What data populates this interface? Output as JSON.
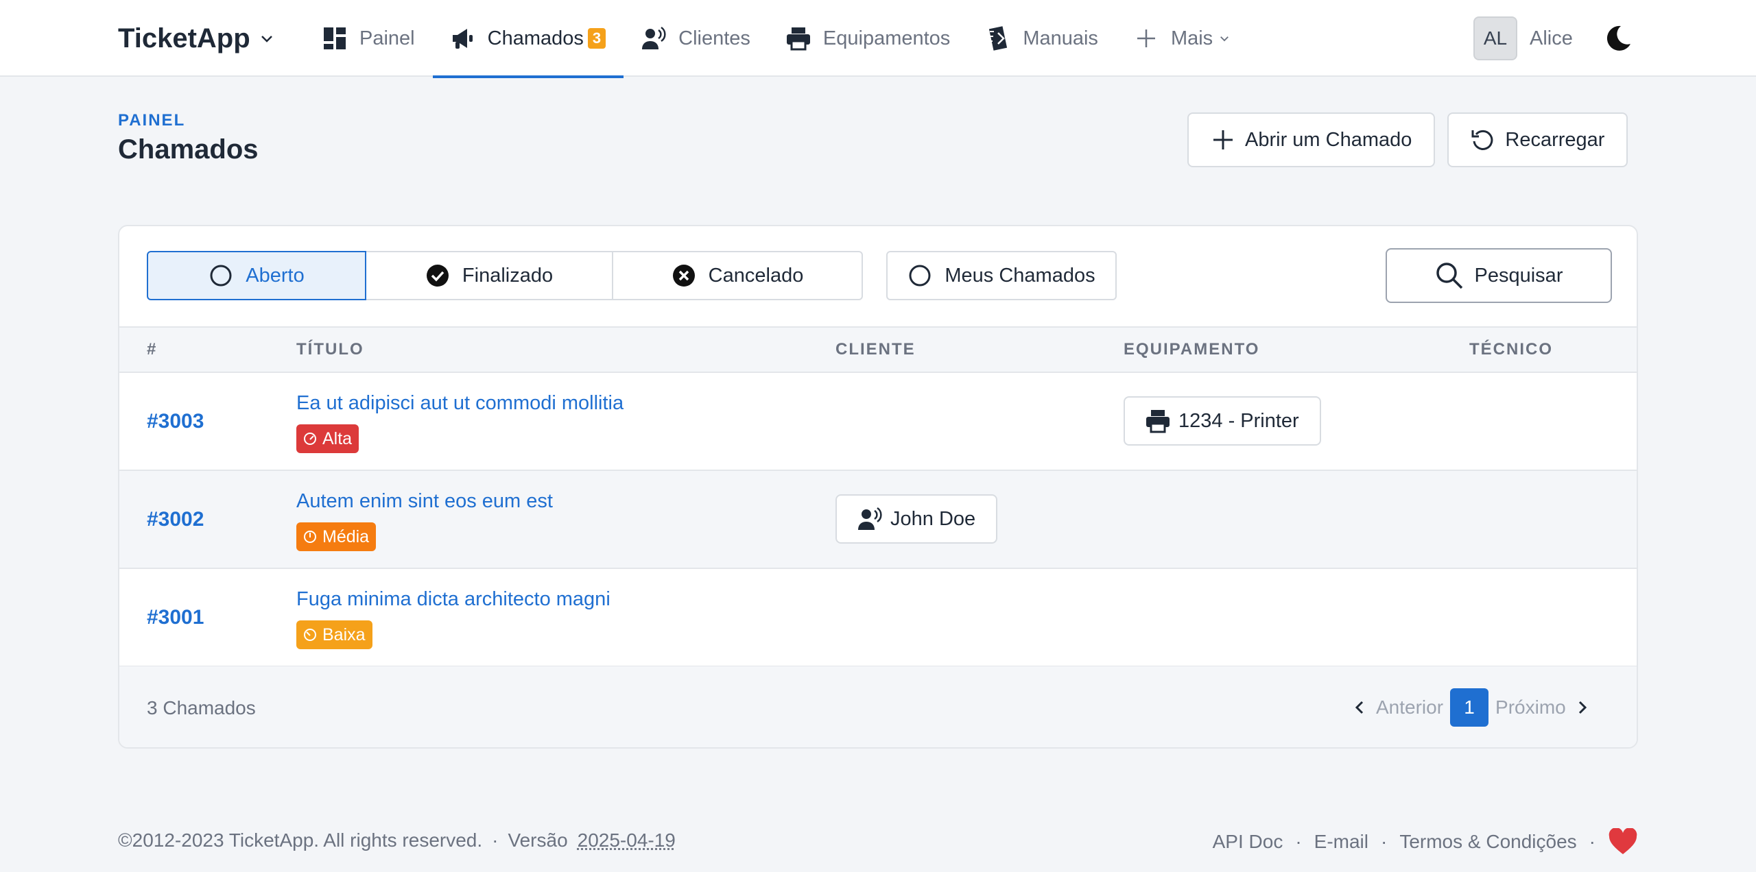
{
  "colors": {
    "primary": "#1f6fd1",
    "badge": "#f5a11a",
    "alta": "#dc3a3a",
    "media": "#f57c10",
    "baixa": "#f5a11a",
    "heart": "#e0393e"
  },
  "navbar": {
    "brand": "TicketApp",
    "items": [
      {
        "label": "Painel",
        "icon": "dashboard-icon"
      },
      {
        "label": "Chamados",
        "icon": "megaphone-icon",
        "badge": "3",
        "active": true
      },
      {
        "label": "Clientes",
        "icon": "customer-icon"
      },
      {
        "label": "Equipamentos",
        "icon": "printer-icon"
      },
      {
        "label": "Manuais",
        "icon": "manual-icon"
      },
      {
        "label": "Mais",
        "icon": "plus-icon"
      }
    ],
    "user_initials": "AL",
    "user_name": "Alice"
  },
  "header": {
    "breadcrumb": "PAINEL",
    "title": "Chamados",
    "new_button": "Abrir um Chamado",
    "reload_button": "Recarregar"
  },
  "filters": {
    "open": "Aberto",
    "finished": "Finalizado",
    "canceled": "Cancelado",
    "mine": "Meus Chamados",
    "search": "Pesquisar"
  },
  "table": {
    "columns": {
      "id": "#",
      "title": "TÍTULO",
      "client": "CLIENTE",
      "equipment": "EQUIPAMENTO",
      "tech": "TÉCNICO"
    },
    "rows": [
      {
        "id": "#3003",
        "title": "Ea ut adipisci aut ut commodi mollitia",
        "priority": "Alta",
        "client": "",
        "equipment": "1234 - Printer"
      },
      {
        "id": "#3002",
        "title": "Autem enim sint eos eum est",
        "priority": "Média",
        "client": "John Doe",
        "equipment": ""
      },
      {
        "id": "#3001",
        "title": "Fuga minima dicta architecto magni",
        "priority": "Baixa",
        "client": "",
        "equipment": ""
      }
    ],
    "count": "3 Chamados",
    "pagination": {
      "prev": "Anterior",
      "current": "1",
      "next": "Próximo"
    }
  },
  "footer": {
    "copyright": "©2012-2023 TicketApp. All rights reserved.",
    "sep": "·",
    "version_label": "Versão",
    "version": "2025-04-19",
    "links": [
      "API Doc",
      "E-mail",
      "Termos & Condições"
    ]
  }
}
